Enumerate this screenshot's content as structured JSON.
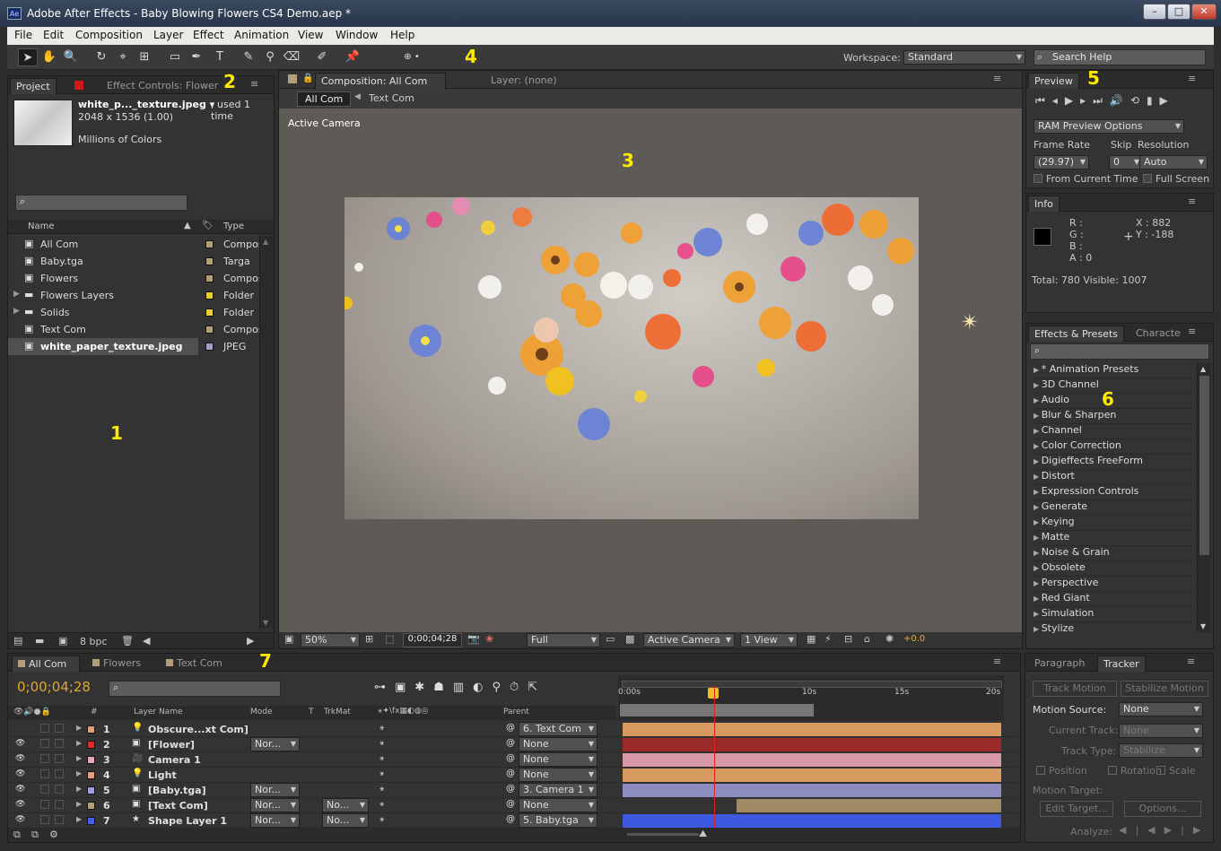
{
  "window": {
    "title": "Adobe After Effects - Baby Blowing Flowers CS4 Demo.aep *",
    "app_icon": "Ae"
  },
  "menu": [
    "File",
    "Edit",
    "Composition",
    "Layer",
    "Effect",
    "Animation",
    "View",
    "Window",
    "Help"
  ],
  "toolbar": {
    "workspace_label": "Workspace:",
    "workspace_value": "Standard",
    "search_placeholder": "Search Help"
  },
  "markers": {
    "m1": "1",
    "m2": "2",
    "m3": "3",
    "m4": "4",
    "m5": "5",
    "m6": "6",
    "m7": "7"
  },
  "project": {
    "tabs": [
      "Project",
      "Effect Controls: Flower"
    ],
    "file_name": "white_p..._texture.jpeg ▾",
    "used": ", used 1 time",
    "dimensions": "2048 x 1536 (1.00)",
    "colors": "Millions of Colors",
    "col_name": "Name",
    "col_type": "Type",
    "items": [
      {
        "name": "All Com",
        "type": "Compos",
        "color": "#b3a07a",
        "icon": "composition-icon"
      },
      {
        "name": "Baby.tga",
        "type": "Targa",
        "color": "#b3a07a",
        "icon": "file-icon"
      },
      {
        "name": "Flowers",
        "type": "Compos",
        "color": "#b3a07a",
        "icon": "composition-icon"
      },
      {
        "name": "Flowers Layers",
        "type": "Folder",
        "color": "#e3cf3a",
        "icon": "folder-icon"
      },
      {
        "name": "Solids",
        "type": "Folder",
        "color": "#e3cf3a",
        "icon": "folder-icon"
      },
      {
        "name": "Text Com",
        "type": "Compos",
        "color": "#b3a07a",
        "icon": "composition-icon"
      },
      {
        "name": "white_paper_texture.jpeg",
        "type": "JPEG",
        "color": "#a0a0c8",
        "icon": "image-icon"
      }
    ],
    "bpc": "8 bpc"
  },
  "composition": {
    "tabs": [
      "Composition: All Com",
      "Layer: (none)"
    ],
    "crumbs": [
      "All Com",
      "Text Com"
    ],
    "view_label": "Active Camera",
    "zoom": "50%",
    "timecode": "0;00;04;28",
    "resolution": "Full",
    "camera": "Active Camera",
    "views": "1 View",
    "exposure": "+0.0"
  },
  "preview": {
    "title": "Preview",
    "ram_options": "RAM Preview Options",
    "frame_rate_label": "Frame Rate",
    "skip_label": "Skip",
    "resolution_label": "Resolution",
    "frame_rate": "(29.97)",
    "skip": "0",
    "resolution": "Auto",
    "from_current": "From Current Time",
    "full_screen": "Full Screen"
  },
  "info": {
    "title": "Info",
    "r": "R :",
    "g": "G :",
    "b": "B :",
    "a": "A : 0",
    "x": "X : 882",
    "y": "Y : -188",
    "total": "Total: 780  Visible: 1007"
  },
  "effects": {
    "tabs": [
      "Effects & Presets",
      "Characte"
    ],
    "items": [
      "* Animation Presets",
      "3D Channel",
      "Audio",
      "Blur & Sharpen",
      "Channel",
      "Color Correction",
      "Digieffects FreeForm",
      "Distort",
      "Expression Controls",
      "Generate",
      "Keying",
      "Matte",
      "Noise & Grain",
      "Obsolete",
      "Perspective",
      "Red Giant",
      "Simulation",
      "Stylize"
    ]
  },
  "timeline": {
    "tabs": [
      "All Com",
      "Flowers",
      "Text Com"
    ],
    "timecode": "0;00;04;28",
    "col_layer": "Layer Name",
    "col_mode": "Mode",
    "col_t": "T",
    "col_trkmat": "TrkMat",
    "col_parent": "Parent",
    "col_num": "#",
    "ruler": [
      "0:00s",
      "10s",
      "15s",
      "20s"
    ],
    "layers": [
      {
        "num": "1",
        "name": "Obscure...xt Com]",
        "mode": "",
        "trk": "",
        "parent": "6. Text Com",
        "color": "#e0a080",
        "bar": "#d69a60",
        "icon": "light-icon"
      },
      {
        "num": "2",
        "name": "[Flower]",
        "mode": "Nor...",
        "trk": "",
        "parent": "None",
        "color": "#d03030",
        "bar": "#9a2a2a",
        "icon": "solid-icon"
      },
      {
        "num": "3",
        "name": "Camera 1",
        "mode": "",
        "trk": "",
        "parent": "None",
        "color": "#e8a8b8",
        "bar": "#d89aa8",
        "icon": "camera-icon"
      },
      {
        "num": "4",
        "name": "Light",
        "mode": "",
        "trk": "",
        "parent": "None",
        "color": "#e0a080",
        "bar": "#d69a60",
        "icon": "light-icon"
      },
      {
        "num": "5",
        "name": "[Baby.tga]",
        "mode": "Nor...",
        "trk": "",
        "parent": "3. Camera 1",
        "color": "#a0a0d8",
        "bar": "#8c8cc0",
        "icon": "file-icon"
      },
      {
        "num": "6",
        "name": "[Text Com]",
        "mode": "Nor...",
        "trk": "No...",
        "parent": "None",
        "color": "#b3a07a",
        "bar": "#a08a64",
        "icon": "composition-icon"
      },
      {
        "num": "7",
        "name": "Shape Layer 1",
        "mode": "Nor...",
        "trk": "No...",
        "parent": "5. Baby.tga",
        "color": "#4a60e0",
        "bar": "#3e58e0",
        "icon": "star-icon"
      }
    ]
  },
  "tracker": {
    "tabs": [
      "Paragraph",
      "Tracker"
    ],
    "track_motion": "Track Motion",
    "stabilize": "Stabilize Motion",
    "motion_source_label": "Motion Source:",
    "motion_source": "None",
    "current_track_label": "Current Track:",
    "current_track": "None",
    "track_type_label": "Track Type:",
    "track_type": "Stabilize",
    "position": "Position",
    "rotation": "Rotation",
    "scale": "Scale",
    "motion_target": "Motion Target:",
    "edit_target": "Edit Target...",
    "options": "Options...",
    "analyze": "Analyze:"
  }
}
